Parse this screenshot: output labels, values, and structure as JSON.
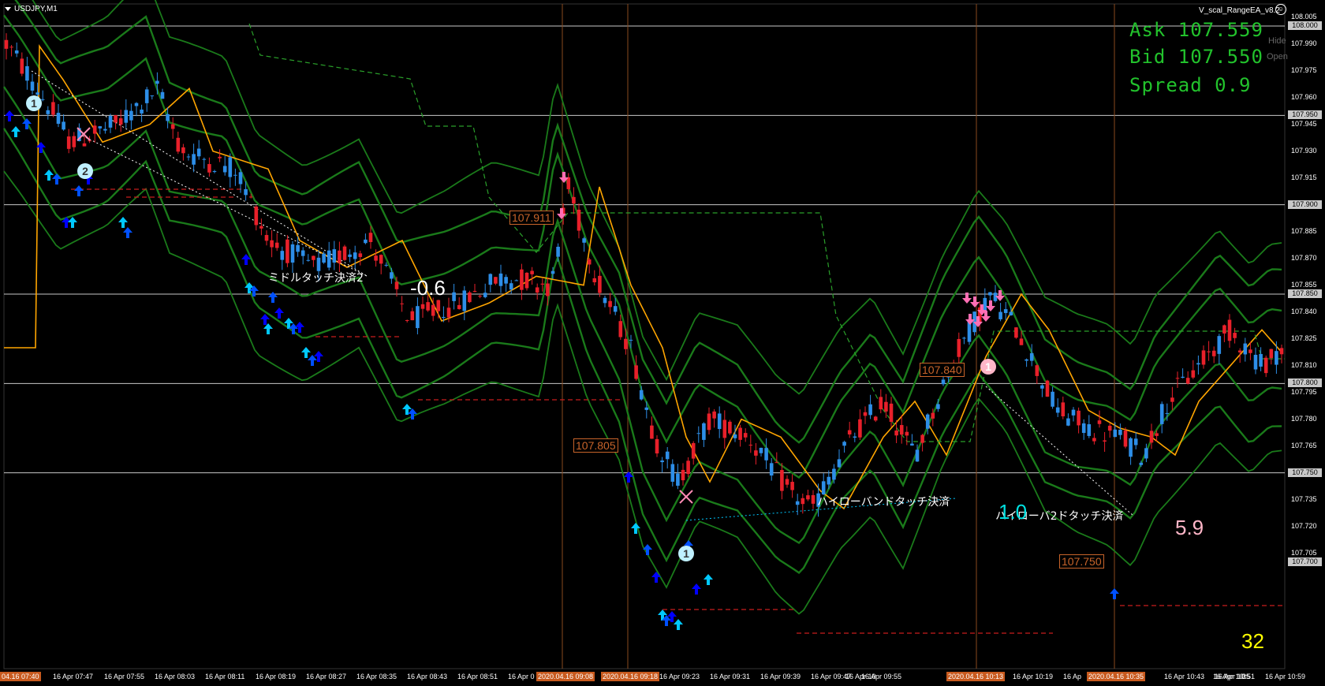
{
  "window": {
    "symbol": "USDJPY,M1",
    "ea_name": "V_scal_RangeEA_v8.2"
  },
  "info": {
    "ask": "Ask 107.559",
    "bid": "Bid 107.550",
    "spread": "Spread 0.9"
  },
  "side_buttons": {
    "hide": "Hide",
    "open": "Open"
  },
  "bar_count": "32",
  "price_axis": {
    "ticks": [
      "108.005",
      "107.990",
      "107.975",
      "107.960",
      "107.945",
      "107.930",
      "107.915",
      "107.885",
      "107.870",
      "107.855",
      "107.840",
      "107.825",
      "107.810",
      "107.795",
      "107.780",
      "107.765",
      "107.735",
      "107.720",
      "107.705"
    ],
    "highlighted": [
      "108.000",
      "107.950",
      "107.900",
      "107.850",
      "107.800",
      "107.750",
      "107.700"
    ]
  },
  "time_axis": {
    "ticks": [
      "16 Apr 07:47",
      "16 Apr 07:55",
      "16 Apr 08:03",
      "16 Apr 08:11",
      "16 Apr 08:19",
      "16 Apr 08:27",
      "16 Apr 08:35",
      "16 Apr 08:43",
      "16 Apr 08:51",
      "16 Apr 09:23",
      "16 Apr 09:31",
      "16 Apr 09:39",
      "16 Apr 09:47",
      "16 Apr 09:55",
      "16 Apr 10:19",
      "16 Apr 10:43",
      "16 Apr 10:51",
      "16 Apr 10:59"
    ],
    "partial": [
      "16 Apr 0",
      "16 Apr 10",
      "16 Ap",
      "16 Apr 10:",
      "35"
    ],
    "highlighted": [
      "04.16 07:40",
      "2020.04.16 09:08",
      "2020.04.16 09:18",
      "2020.04.16 10:13",
      "2020.04.16 10:35"
    ]
  },
  "price_labels": [
    "107.911",
    "107.805",
    "107.840",
    "107.750"
  ],
  "annotations": {
    "middle_touch": "ミドルタッチ決済2",
    "result_1": "-0.6",
    "hilo_touch": "ハイローバンドタッチ決済",
    "hilo_touch_2": "ハイローバ2ドタッチ決済",
    "result_2": "1.0",
    "result_3": "5.9"
  },
  "badges": [
    "1",
    "2",
    "1",
    "1"
  ],
  "colors": {
    "bull": "#2d8ee8",
    "bear": "#e8202a",
    "ma": "#ffa500",
    "band": "#1a7a1a",
    "signal_buy": "#00c8ff",
    "signal_sell": "#ff6eb4",
    "info": "#22c22c"
  }
}
